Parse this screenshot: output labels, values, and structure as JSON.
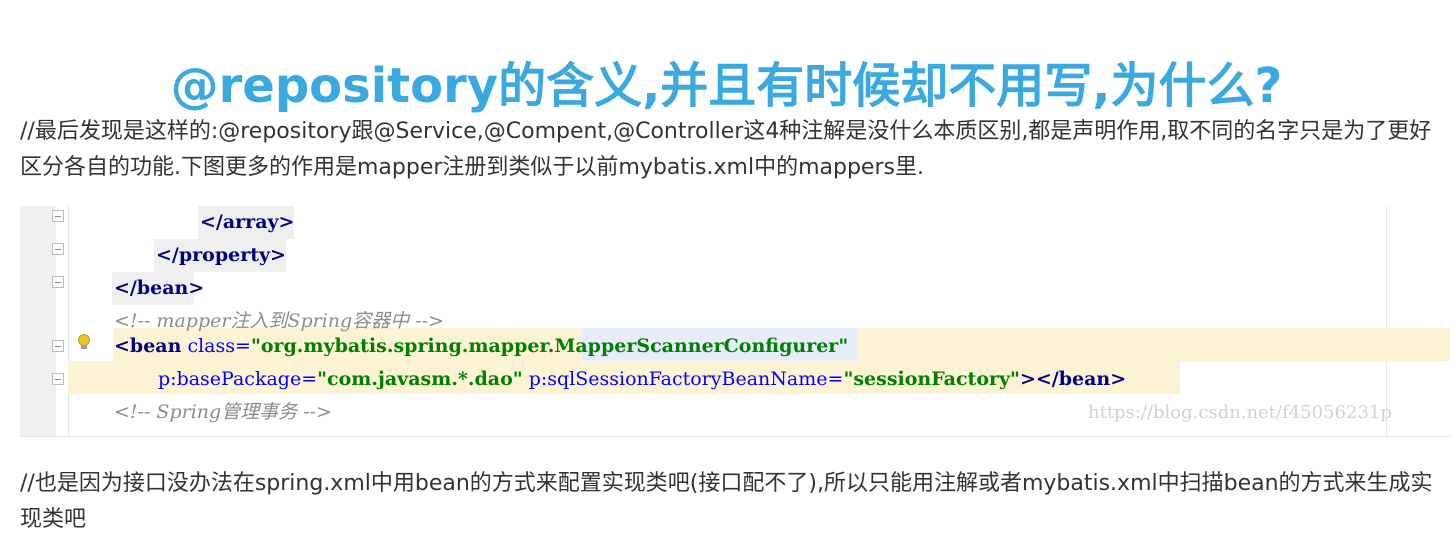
{
  "title": "@repository的含义,并且有时候却不用写,为什么?",
  "paragraphs": {
    "intro": "//最后发现是这样的:@repository跟@Service,@Compent,@Controller这4种注解是没什么本质区别,都是声明作用,取不同的名字只是为了更好区分各自的功能.下图更多的作用是mapper注册到类似于以前mybatis.xml中的mappers里.",
    "outro": "//也是因为接口没办法在spring.xml中用bean的方式来配置实现类吧(接口配不了),所以只能用注解或者mybatis.xml中扫描bean的方式来生成实现类吧"
  },
  "code": {
    "line1": {
      "tag": "</array>"
    },
    "line2": {
      "tag": "</property>"
    },
    "line3": {
      "tag": "</bean>"
    },
    "line4": {
      "comment": "<!-- mapper注入到Spring容器中 -->"
    },
    "line5": {
      "open": "<bean",
      "attr": "class=",
      "value_a": "\"org.mybatis.spring.mapper.",
      "value_b": "MapperScannerConfigurer",
      "value_c": "\""
    },
    "line6": {
      "attr1": "p:basePackage=",
      "value1": "\"com.javasm.*.dao\"",
      "attr2": "p:sqlSessionFactoryBeanName=",
      "value2": "\"sessionFactory\"",
      "gt": ">",
      "close": "</bean>"
    },
    "line7": {
      "comment": "<!-- Spring管理事务 -->"
    }
  },
  "watermark": "https://blog.csdn.net/f45056231p",
  "colors": {
    "title": "#3aa9e0",
    "tag": "#000080",
    "attribute": "#0000ff",
    "value": "#008000",
    "comment": "#8c8c8c",
    "highlight": "#fbf3d3"
  },
  "icons": [
    "fold-marker-icon",
    "lightbulb-icon"
  ]
}
